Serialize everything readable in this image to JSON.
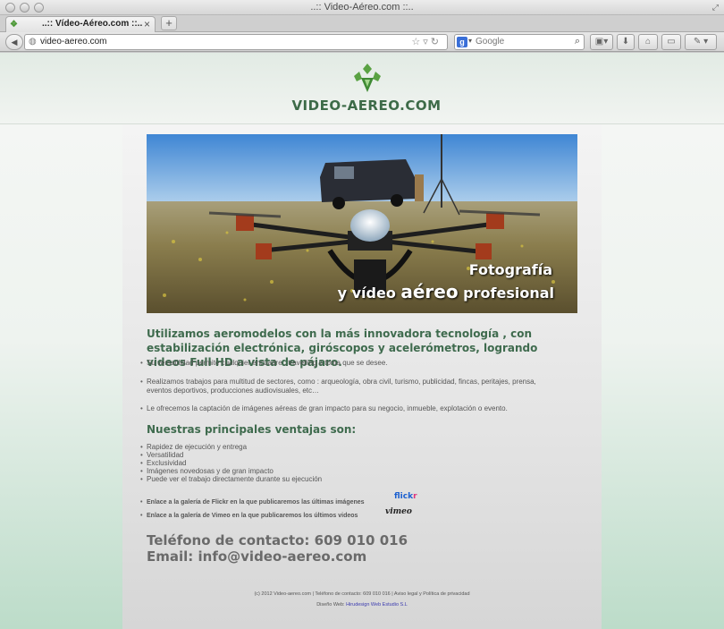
{
  "window": {
    "title": "..:: Video-Aéreo.com ::.."
  },
  "tab": {
    "title": "..:: Vídeo-Aéreo.com ::..",
    "close": "×",
    "new_tab": "+"
  },
  "toolbar": {
    "back": "◀",
    "url": "video-aereo.com",
    "url_actions": "☆▿↻",
    "search_engine": "g",
    "search_placeholder": "Google",
    "search_icon": "⌕"
  },
  "site": {
    "logo_text": "VIDEO-AEREO.COM",
    "hero_caption_line1": "Fotografía",
    "hero_caption_line2_a": "y vídeo ",
    "hero_caption_line2_b": "aéreo",
    "hero_caption_line2_c": " profesional",
    "intro": "Utilizamos aeromodelos con la más innovadora tecnología , con estabilización electrónica, giróscopos y acelerómetros, logrando videos Full HD a vista de pájaro.",
    "services": [
      "Su versatilidad permite cualquier encuadre , travelling o toma que se desee.",
      "Realizamos trabajos para multitud de sectores, como : arqueología, obra civil, turismo, publicidad, fincas, peritajes, prensa, eventos deportivos, producciones audiovisuales, etc…",
      "Le ofrecemos la captación de imágenes aéreas de gran impacto para su negocio, inmueble, explotación o evento."
    ],
    "advantages_title": "Nuestras principales ventajas son:",
    "advantages": [
      "Rapidez de ejecución y entrega",
      "Versatilidad",
      "Exclusividad",
      "Imágenes novedosas y de gran impacto",
      "Puede ver el trabajo directamente durante su ejecución"
    ],
    "flickr_link": "Enlace a la galería de Flickr en la que publicaremos las últimas imágenes",
    "flickr_logo_a": "flick",
    "flickr_logo_b": "r",
    "vimeo_link": "Enlace a la galería de Vimeo en la que publicaremos los últimos videos",
    "vimeo_logo": "vimeo",
    "phone": "Teléfono de contacto: 609 010 016",
    "email": "Email: info@video-aereo.com",
    "footer_line1": "(c) 2012 Video-aereo.com | Teléfono de contacto: 609 010 016 | Aviso legal y Política de privacidad",
    "footer_design_label": "Diseño Web: ",
    "footer_design_link": "Hirudesign Web Estudio S.L"
  }
}
